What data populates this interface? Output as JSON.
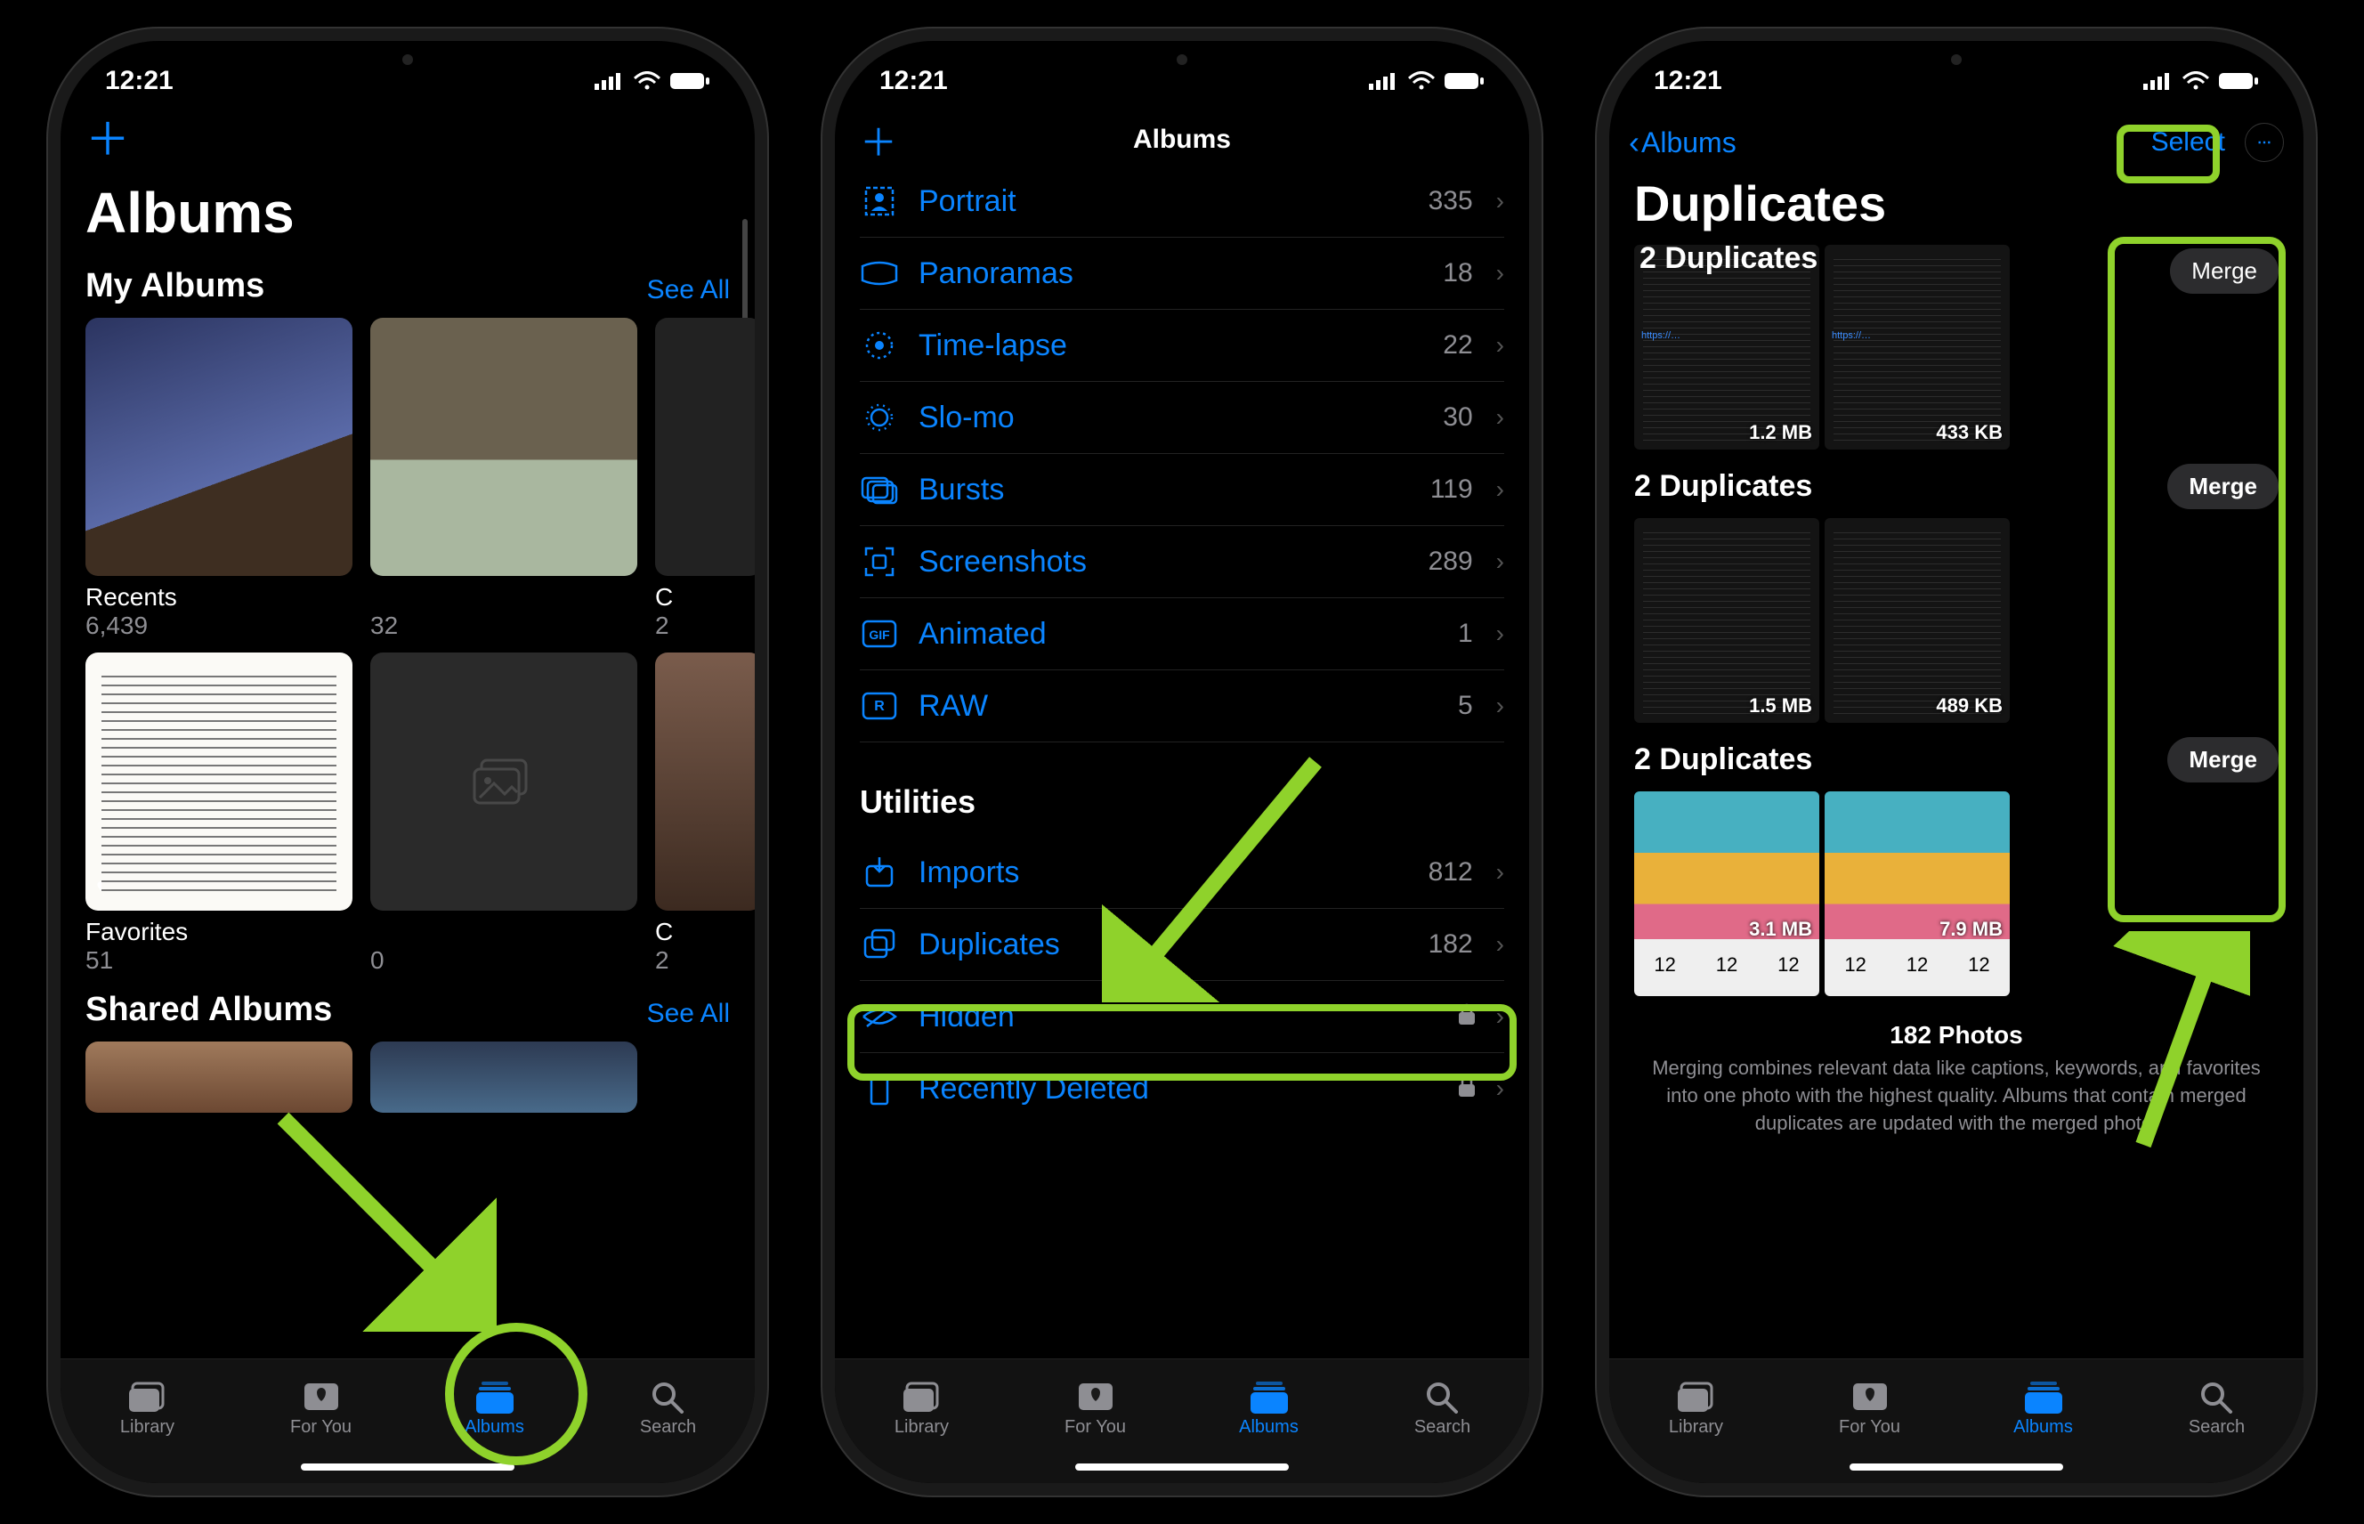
{
  "status": {
    "time": "12:21"
  },
  "tabs": {
    "library": "Library",
    "foryou": "For You",
    "albums": "Albums",
    "search": "Search"
  },
  "screen1": {
    "title": "Albums",
    "my_albums": "My Albums",
    "shared_albums": "Shared Albums",
    "see_all": "See All",
    "tiles": [
      {
        "name": "Recents",
        "count": "6,439"
      },
      {
        "name_cut": "C",
        "count": "32"
      },
      {
        "name_cut2": "C",
        "count2": "2"
      },
      {
        "name": "Favorites",
        "count": "51"
      },
      {
        "name_cut": "C",
        "count": "0"
      },
      {
        "name_cut2": "C",
        "count2": "2"
      }
    ],
    "tile_recents": "Recents",
    "tile_recents_count": "6,439",
    "tile2_count": "32",
    "tile_c": "C",
    "tile_c_count": "2",
    "tile_fav": "Favorites",
    "tile_fav_count": "51",
    "tile5_count": "0"
  },
  "screen2": {
    "title": "Albums",
    "utilities": "Utilities",
    "rows": {
      "portrait": {
        "label": "Portrait",
        "count": "335"
      },
      "panoramas": {
        "label": "Panoramas",
        "count": "18"
      },
      "timelapse": {
        "label": "Time-lapse",
        "count": "22"
      },
      "slomo": {
        "label": "Slo-mo",
        "count": "30"
      },
      "bursts": {
        "label": "Bursts",
        "count": "119"
      },
      "screenshots": {
        "label": "Screenshots",
        "count": "289"
      },
      "animated": {
        "label": "Animated",
        "count": "1"
      },
      "raw": {
        "label": "RAW",
        "count": "5"
      },
      "imports": {
        "label": "Imports",
        "count": "812"
      },
      "duplicates": {
        "label": "Duplicates",
        "count": "182"
      },
      "hidden": {
        "label": "Hidden"
      },
      "deleted": {
        "label": "Recently Deleted"
      }
    }
  },
  "screen3": {
    "back": "Albums",
    "select": "Select",
    "title": "Duplicates",
    "groups": [
      {
        "heading": "2 Duplicates",
        "merge": "Merge",
        "sizes": [
          "1.2 MB",
          "433 KB"
        ]
      },
      {
        "heading": "2 Duplicates",
        "merge": "Merge",
        "sizes": [
          "1.5 MB",
          "489 KB"
        ]
      },
      {
        "heading": "2 Duplicates",
        "merge": "Merge",
        "sizes": [
          "3.1 MB",
          "7.9 MB"
        ]
      }
    ],
    "cal": "12",
    "footer_count": "182 Photos",
    "footer_text": "Merging combines relevant data like captions, keywords, and favorites into one photo with the highest quality. Albums that contain merged duplicates are updated with the merged photo."
  }
}
